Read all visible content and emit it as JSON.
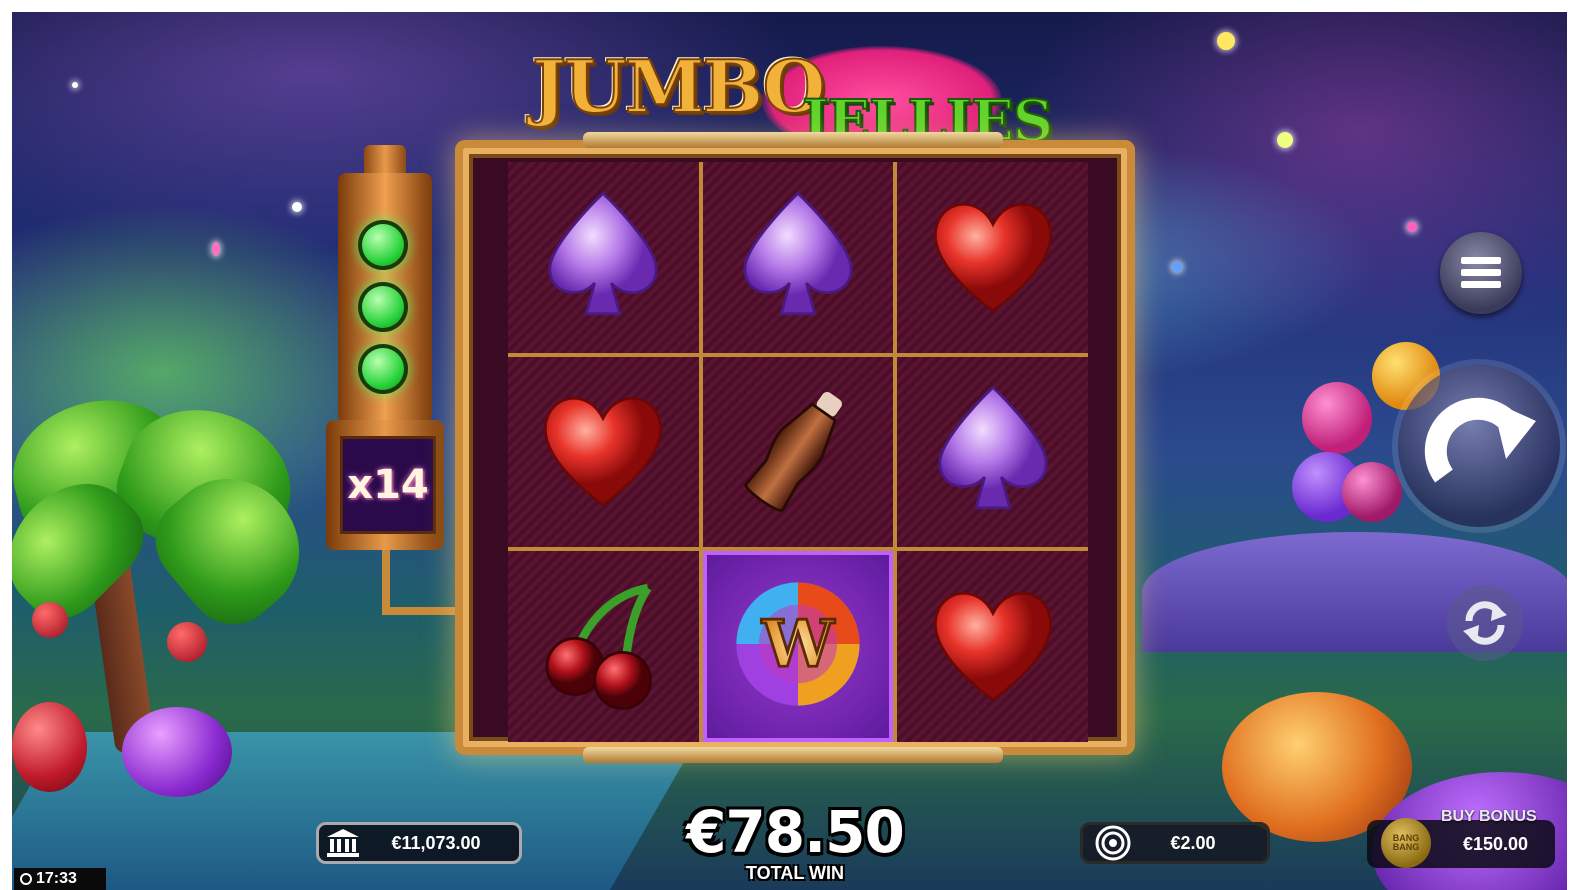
{
  "game": {
    "title_word1": "JUMBO",
    "title_word2": "JELLIES"
  },
  "multiplier": {
    "label": "x14",
    "lamps_lit": 3
  },
  "reels": [
    [
      "spade",
      "spade",
      "heart"
    ],
    [
      "heart",
      "cola-bottle",
      "spade"
    ],
    [
      "cherry",
      "wild",
      "heart"
    ]
  ],
  "wild_symbol_letter": "W",
  "balance": {
    "icon": "bank-icon",
    "value": "€11,073.00"
  },
  "win": {
    "amount": "€78.50",
    "label": "TOTAL WIN"
  },
  "bet": {
    "icon": "chip-icon",
    "value": "€2.00"
  },
  "buy_bonus": {
    "label": "BUY BONUS",
    "price": "€150.00",
    "coin_text": "BANG BANG"
  },
  "clock": "17:33",
  "colors": {
    "spade": "#b57ae8",
    "heart": "#e8332a",
    "lamp": "#28d23a",
    "frame": "#c98a3a"
  }
}
